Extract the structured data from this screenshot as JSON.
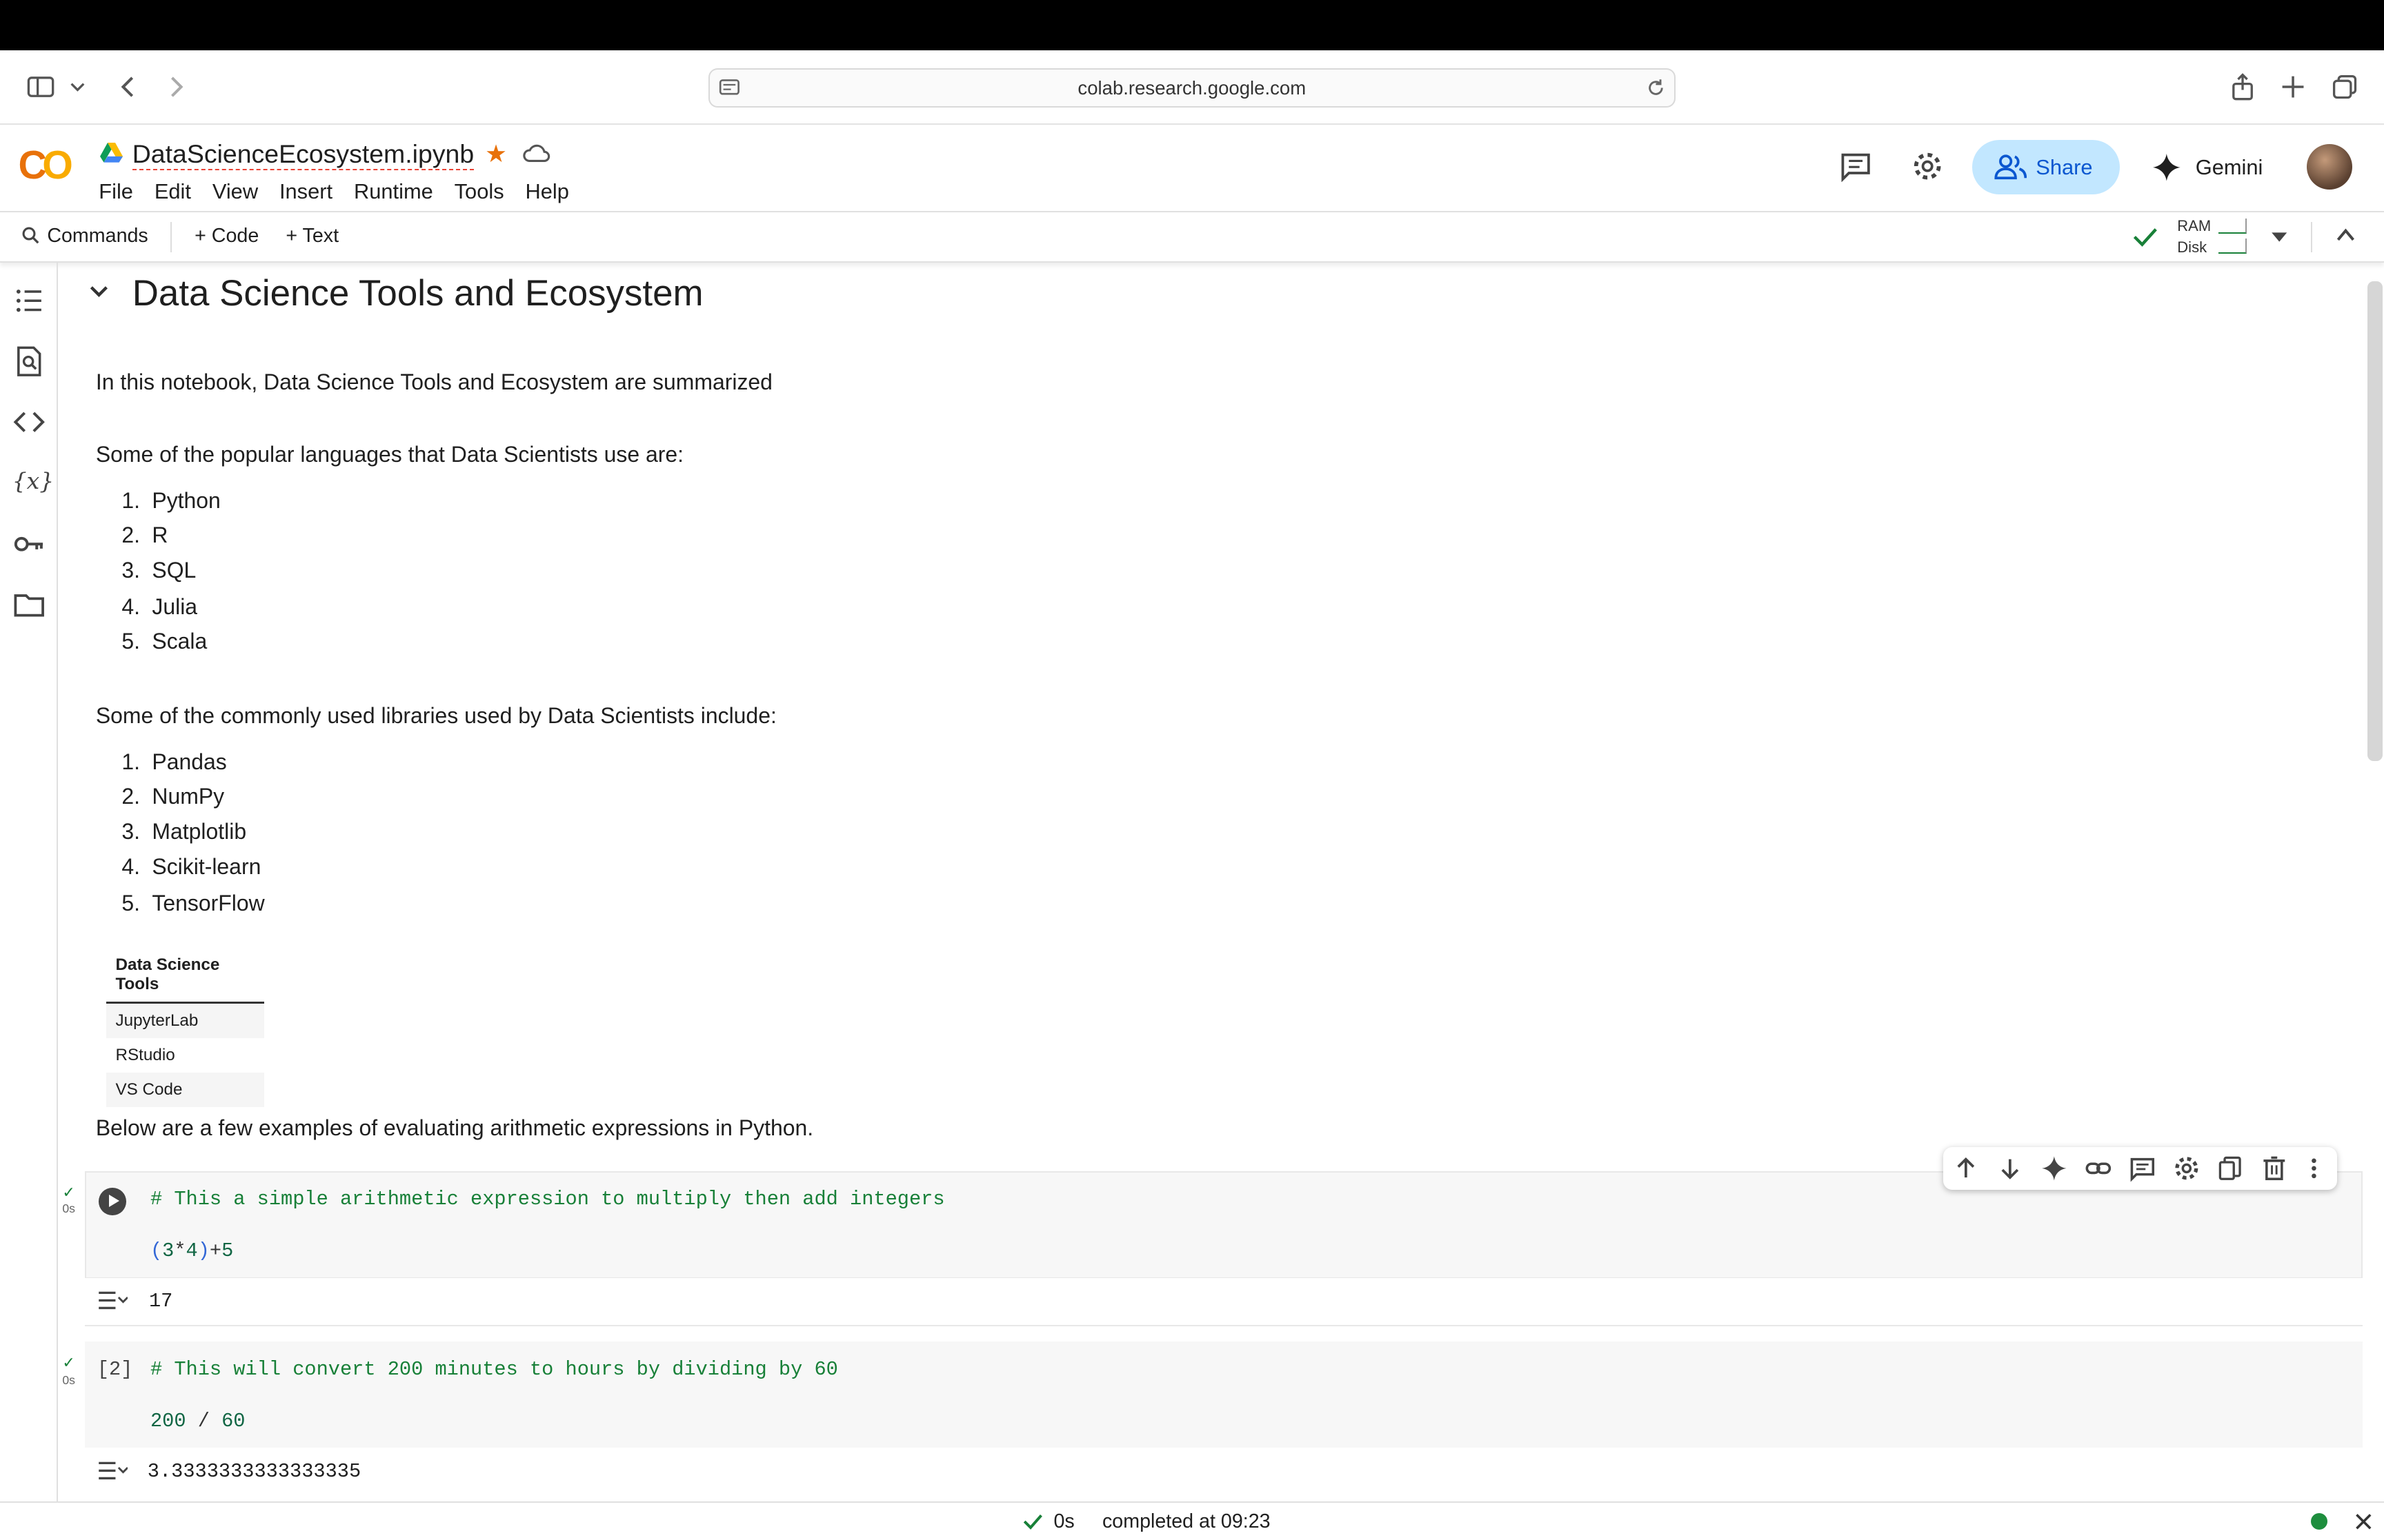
{
  "browser": {
    "url": "colab.research.google.com"
  },
  "colab": {
    "logo": "CO",
    "notebook_name": "DataScienceEcosystem.ipynb",
    "menu": [
      "File",
      "Edit",
      "View",
      "Insert",
      "Runtime",
      "Tools",
      "Help"
    ],
    "share_label": "Share",
    "gemini_label": "Gemini"
  },
  "toolbar": {
    "commands_label": "Commands",
    "add_code_label": "+ Code",
    "add_text_label": "+ Text",
    "ram_label": "RAM",
    "disk_label": "Disk"
  },
  "notebook": {
    "heading": "Data Science Tools and Ecosystem",
    "intro": "In this notebook, Data Science Tools and Ecosystem are summarized",
    "languages_intro": "Some of the popular languages that Data Scientists use are:",
    "languages": [
      "Python",
      "R",
      "SQL",
      "Julia",
      "Scala"
    ],
    "libraries_intro": "Some of the commonly used libraries used by Data Scientists include:",
    "libraries": [
      "Pandas",
      "NumPy",
      "Matplotlib",
      "Scikit-learn",
      "TensorFlow"
    ],
    "tools_table": {
      "header": "Data Science Tools",
      "rows": [
        "JupyterLab",
        "RStudio",
        "VS Code"
      ]
    },
    "arith_intro": "Below are a few examples of evaluating arithmetic expressions in Python.",
    "cells": [
      {
        "exec_label": "",
        "time": "0s",
        "comment": "# This a simple arithmetic expression to multiply then add integers",
        "code_open": "(",
        "code_a": "3",
        "code_op1": "*",
        "code_b": "4",
        "code_close": ")",
        "code_op2": "+",
        "code_c": "5",
        "output": "17"
      },
      {
        "exec_label": "[2]",
        "time": "0s",
        "comment": "# This will convert 200 minutes to hours by dividing by 60",
        "code_a": "200",
        "code_op1": " / ",
        "code_b": "60",
        "output": "3.3333333333333335"
      }
    ]
  },
  "status": {
    "time": "0s",
    "message": "completed at 09:23"
  },
  "colors": {
    "accent": "#0b57d0",
    "share_bg": "#c2e7ff",
    "success": "#188038",
    "logo_yellow": "#f9ab00",
    "logo_orange": "#e8710a"
  }
}
